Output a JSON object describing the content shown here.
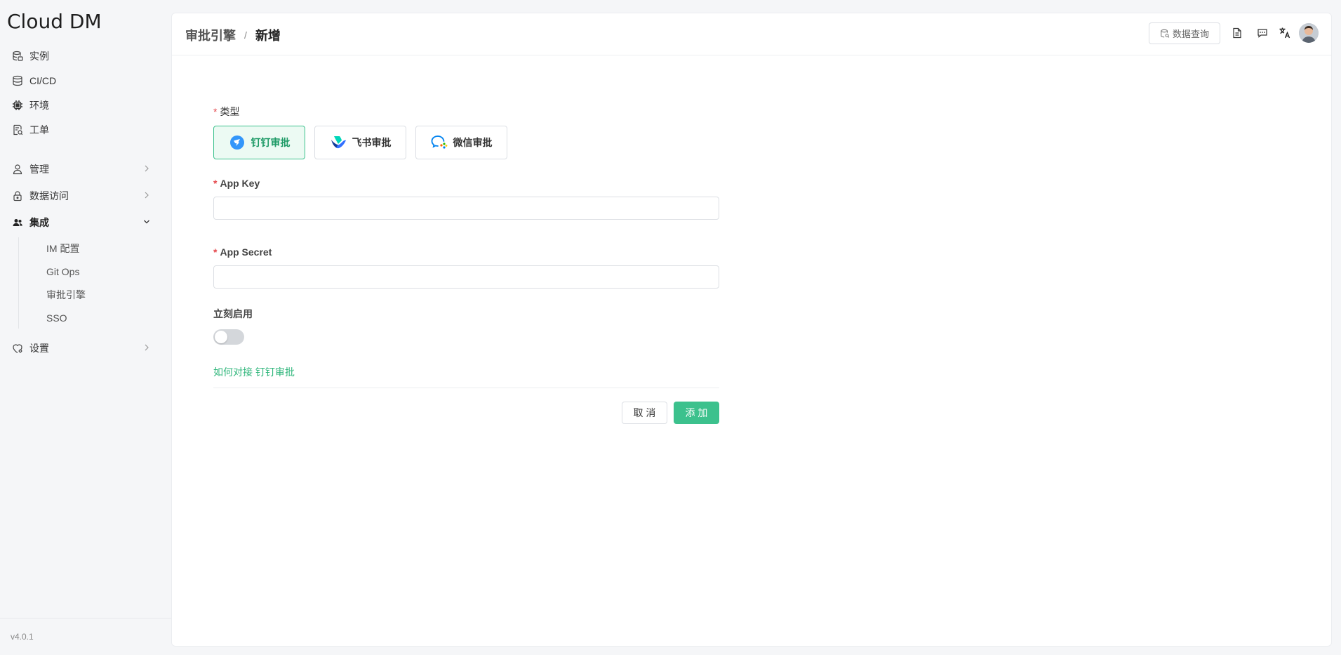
{
  "app": {
    "logo": "Cloud DM",
    "version": "v4.0.1"
  },
  "sidebar": {
    "items": [
      {
        "label": "实例",
        "icon": "database-stack-icon"
      },
      {
        "label": "CI/CD",
        "icon": "database-icon"
      },
      {
        "label": "环境",
        "icon": "chip-icon"
      },
      {
        "label": "工单",
        "icon": "ticket-icon"
      },
      {
        "label": "管理",
        "icon": "user-icon"
      },
      {
        "label": "数据访问",
        "icon": "lock-icon"
      },
      {
        "label": "集成",
        "icon": "team-icon"
      },
      {
        "label": "设置",
        "icon": "settings-icon"
      }
    ],
    "submenu": [
      {
        "label": "IM 配置"
      },
      {
        "label": "Git Ops"
      },
      {
        "label": "审批引擎"
      },
      {
        "label": "SSO"
      }
    ]
  },
  "header": {
    "breadcrumb": {
      "parent": "审批引擎",
      "separator": "/",
      "current": "新增"
    },
    "query_button": "数据查询"
  },
  "form": {
    "type_label": "类型",
    "required_mark": "*",
    "types": [
      {
        "label": "钉钉审批",
        "icon": "dingtalk-icon",
        "selected": true
      },
      {
        "label": "飞书审批",
        "icon": "feishu-icon",
        "selected": false
      },
      {
        "label": "微信审批",
        "icon": "wechat-work-icon",
        "selected": false
      }
    ],
    "app_key_label": "App Key",
    "app_key_value": "",
    "app_secret_label": "App Secret",
    "app_secret_value": "",
    "enable_label": "立刻启用",
    "enable_value": false,
    "help_link": "如何对接 钉钉审批",
    "cancel_label": "取 消",
    "submit_label": "添 加"
  },
  "colors": {
    "accent": "#3cc18d",
    "required": "#e5484d",
    "link": "#2fb67b"
  }
}
